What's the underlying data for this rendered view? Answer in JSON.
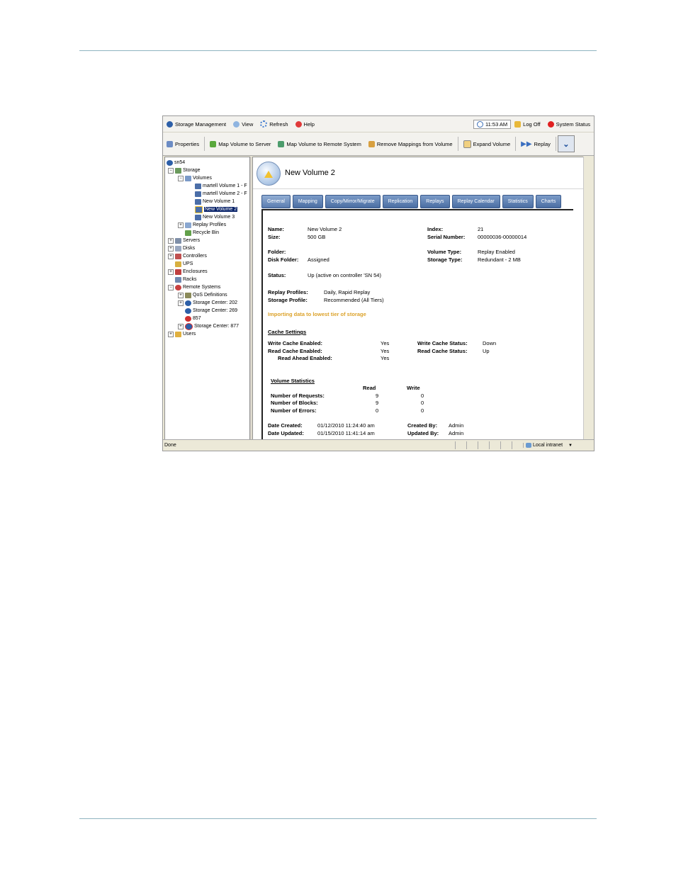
{
  "toolbar1": {
    "storage_mgmt": "Storage Management",
    "view": "View",
    "refresh": "Refresh",
    "help": "Help",
    "time": "11:53 AM",
    "logoff": "Log Off",
    "system_status": "System Status"
  },
  "toolbar2": {
    "properties": "Properties",
    "map_server": "Map Volume to Server",
    "map_remote": "Map Volume to Remote System",
    "remove_mappings": "Remove Mappings from Volume",
    "expand_volume": "Expand Volume",
    "replay": "Replay"
  },
  "tree": {
    "root": "sn54",
    "storage": "Storage",
    "volumes": "Volumes",
    "vol_m1": "martell Volume 1 - F",
    "vol_m2": "martell Volume 2 - F",
    "vol_n1": "New Volume 1",
    "vol_n2": "New Volume 2",
    "vol_n3": "New Volume 3",
    "replay_profiles": "Replay Profiles",
    "recycle_bin": "Recycle Bin",
    "servers": "Servers",
    "disks": "Disks",
    "controllers": "Controllers",
    "ups": "UPS",
    "enclosures": "Enclosures",
    "racks": "Racks",
    "remote_systems": "Remote Systems",
    "qos": "QoS Definitions",
    "sc202": "Storage Center: 202",
    "sc269": "Storage Center: 269",
    "n857": "857",
    "sc877": "Storage Center: 877",
    "users": "Users"
  },
  "main": {
    "title": "New Volume 2",
    "tabs": [
      "General",
      "Mapping",
      "Copy/Mirror/Migrate",
      "Replication",
      "Replays",
      "Replay Calendar",
      "Statistics",
      "Charts"
    ],
    "name_lbl": "Name:",
    "name_val": "New Volume 2",
    "size_lbl": "Size:",
    "size_val": "500 GB",
    "index_lbl": "Index:",
    "index_val": "21",
    "serial_lbl": "Serial Number:",
    "serial_val": "00000036-00000014",
    "folder_lbl": "Folder:",
    "diskfolder_lbl": "Disk Folder:",
    "diskfolder_val": "Assigned",
    "voltype_lbl": "Volume Type:",
    "voltype_val": "Replay Enabled",
    "stortype_lbl": "Storage Type:",
    "stortype_val": "Redundant - 2 MB",
    "status_lbl": "Status:",
    "status_val": "Up (active on controller 'SN 54)",
    "replayprof_lbl": "Replay Profiles:",
    "replayprof_val": "Daily, Rapid Replay",
    "storprof_lbl": "Storage Profile:",
    "storprof_val": "Recommended (All Tiers)",
    "importing": "Importing data to lowest tier of storage",
    "cache_title": "Cache Settings",
    "wce_lbl": "Write Cache Enabled:",
    "wce_val": "Yes",
    "rce_lbl": "Read Cache Enabled:",
    "rce_val": "Yes",
    "rae_lbl": "Read Ahead Enabled:",
    "rae_val": "Yes",
    "wcs_lbl": "Write Cache Status:",
    "wcs_val": "Down",
    "rcs_lbl": "Read Cache Status:",
    "rcs_val": "Up",
    "stats_title": "Volume Statistics",
    "read_hdr": "Read",
    "write_hdr": "Write",
    "req_lbl": "Number of Requests:",
    "req_read": "9",
    "req_write": "0",
    "blk_lbl": "Number of Blocks:",
    "blk_read": "9",
    "blk_write": "0",
    "err_lbl": "Number of Errors:",
    "err_read": "0",
    "err_write": "0",
    "created_lbl": "Date Created:",
    "created_val": "01/12/2010 11:24:40 am",
    "updated_lbl": "Date Updated:",
    "updated_val": "01/15/2010 11:41:14 am",
    "createdby_lbl": "Created By:",
    "createdby_val": "Admin",
    "updatedby_lbl": "Updated By:",
    "updatedby_val": "Admin"
  },
  "statusbar": {
    "left": "Done",
    "zone": "Local intranet"
  }
}
